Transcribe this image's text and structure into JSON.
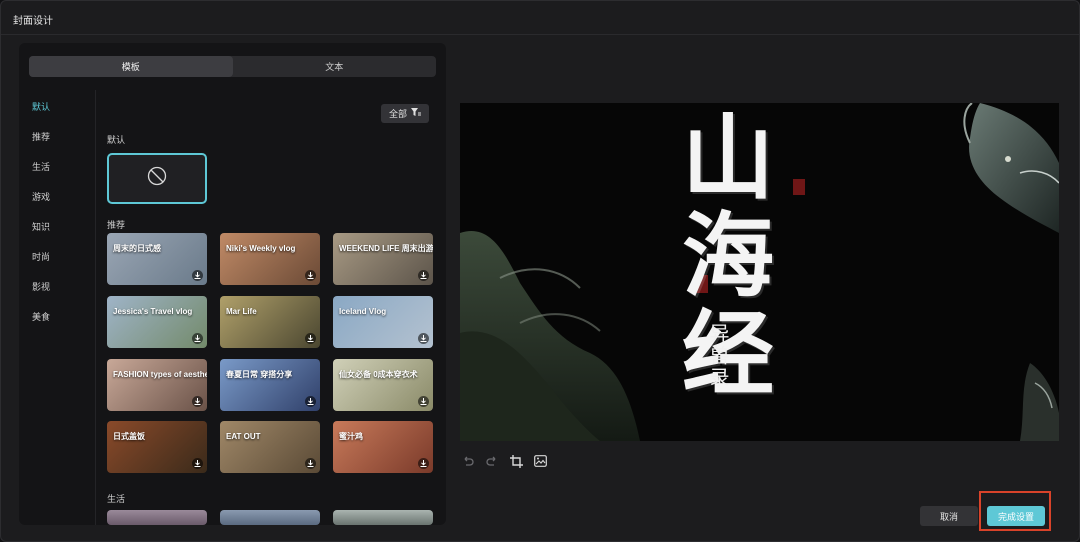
{
  "window": {
    "title": "封面设计"
  },
  "tabs": [
    {
      "label": "模板",
      "active": true
    },
    {
      "label": "文本",
      "active": false
    }
  ],
  "categories": [
    {
      "label": "默认",
      "active": true
    },
    {
      "label": "推荐"
    },
    {
      "label": "生活"
    },
    {
      "label": "游戏"
    },
    {
      "label": "知识"
    },
    {
      "label": "时尚"
    },
    {
      "label": "影视"
    },
    {
      "label": "美食"
    }
  ],
  "filter": {
    "label": "全部",
    "icon": "filter-icon"
  },
  "sections": {
    "default": "默认",
    "recommend": "推荐",
    "life": "生活"
  },
  "templates": [
    {
      "caption": "周末的日式感",
      "colors": [
        "#9aa6b4",
        "#6a7a8a"
      ]
    },
    {
      "caption": "Niki's Weekly vlog",
      "colors": [
        "#c08a66",
        "#6b4a36"
      ]
    },
    {
      "caption": "WEEKEND LIFE 周末出游日记",
      "colors": [
        "#a89a84",
        "#5c544a"
      ]
    },
    {
      "caption": "Jessica's Travel vlog",
      "colors": [
        "#9fb4c8",
        "#738a6a"
      ]
    },
    {
      "caption": "Mar Life",
      "colors": [
        "#b0a06a",
        "#4a4630"
      ]
    },
    {
      "caption": "Iceland Vlog",
      "colors": [
        "#8aa8c4",
        "#b4c2d0"
      ]
    },
    {
      "caption": "FASHION types of aesthetic",
      "colors": [
        "#c8a898",
        "#6a5248"
      ]
    },
    {
      "caption": "春夏日常 穿搭分享",
      "colors": [
        "#7a9ac8",
        "#30406a"
      ]
    },
    {
      "caption": "仙女必备 0成本穿衣术",
      "colors": [
        "#d0d0b8",
        "#8a8a68"
      ]
    },
    {
      "caption": "日式盖饭",
      "colors": [
        "#8a4a2a",
        "#3a2a1a"
      ]
    },
    {
      "caption": "EAT OUT",
      "colors": [
        "#a08868",
        "#5a4a36"
      ]
    },
    {
      "caption": "蜜汁鸡",
      "colors": [
        "#c87a5a",
        "#7a3a2a"
      ]
    }
  ],
  "preview": {
    "title": "山海经",
    "subtitle": "异兽录"
  },
  "tools": [
    "undo-icon",
    "redo-icon",
    "crop-icon",
    "image-edit-icon"
  ],
  "buttons": {
    "cancel": "取消",
    "confirm": "完成设置"
  },
  "accent": "#5ec8d6",
  "highlight_color": "#d9432a"
}
